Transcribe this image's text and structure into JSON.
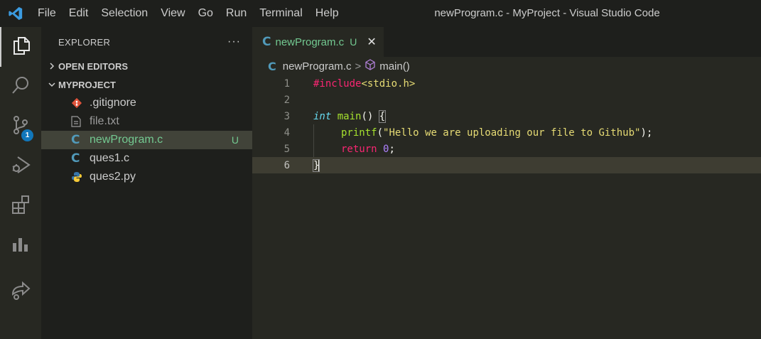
{
  "menu": [
    "File",
    "Edit",
    "Selection",
    "View",
    "Go",
    "Run",
    "Terminal",
    "Help"
  ],
  "window_title": "newProgram.c - MyProject - Visual Studio Code",
  "activity_bar": {
    "items": [
      {
        "icon": "files-icon",
        "active": true
      },
      {
        "icon": "search-icon"
      },
      {
        "icon": "source-control-icon",
        "badge": "1"
      },
      {
        "icon": "run-debug-icon"
      },
      {
        "icon": "extensions-icon"
      },
      {
        "icon": "chart-icon"
      },
      {
        "icon": "live-share-icon"
      }
    ],
    "scm_badge": "1"
  },
  "sidebar": {
    "title": "EXPLORER",
    "more": "···",
    "open_editors_label": "OPEN EDITORS",
    "project_label": "MYPROJECT",
    "files": [
      {
        "name": ".gitignore",
        "icon": "git-icon"
      },
      {
        "name": "file.txt",
        "icon": "text-file-icon"
      },
      {
        "name": "newProgram.c",
        "icon": "c-file-icon",
        "status": "U",
        "selected": true
      },
      {
        "name": "ques1.c",
        "icon": "c-file-icon"
      },
      {
        "name": "ques2.py",
        "icon": "python-file-icon"
      }
    ]
  },
  "editor": {
    "tab": {
      "label": "newProgram.c",
      "status": "U",
      "close": "✕",
      "icon": "C"
    },
    "breadcrumb": {
      "file": "newProgram.c",
      "separator": ">",
      "symbol": "main()",
      "icon": "C"
    },
    "line_numbers": [
      "1",
      "2",
      "3",
      "4",
      "5",
      "6"
    ],
    "code": {
      "l1_directive": "#include",
      "l1_header": "<stdio.h>",
      "l3_type": "int",
      "l3_func": "main",
      "l3_rest": "() ",
      "l3_brace": "{",
      "l4_func": "printf",
      "l4_open": "(",
      "l4_string": "\"Hello we are uploading our file to Github\"",
      "l4_close": ");",
      "l5_kw": "return",
      "l5_num": "0",
      "l5_end": ";",
      "l6_brace": "}"
    }
  },
  "colors": {
    "accent": "#519aba",
    "untracked": "#73c991",
    "badge": "#1177bb"
  }
}
